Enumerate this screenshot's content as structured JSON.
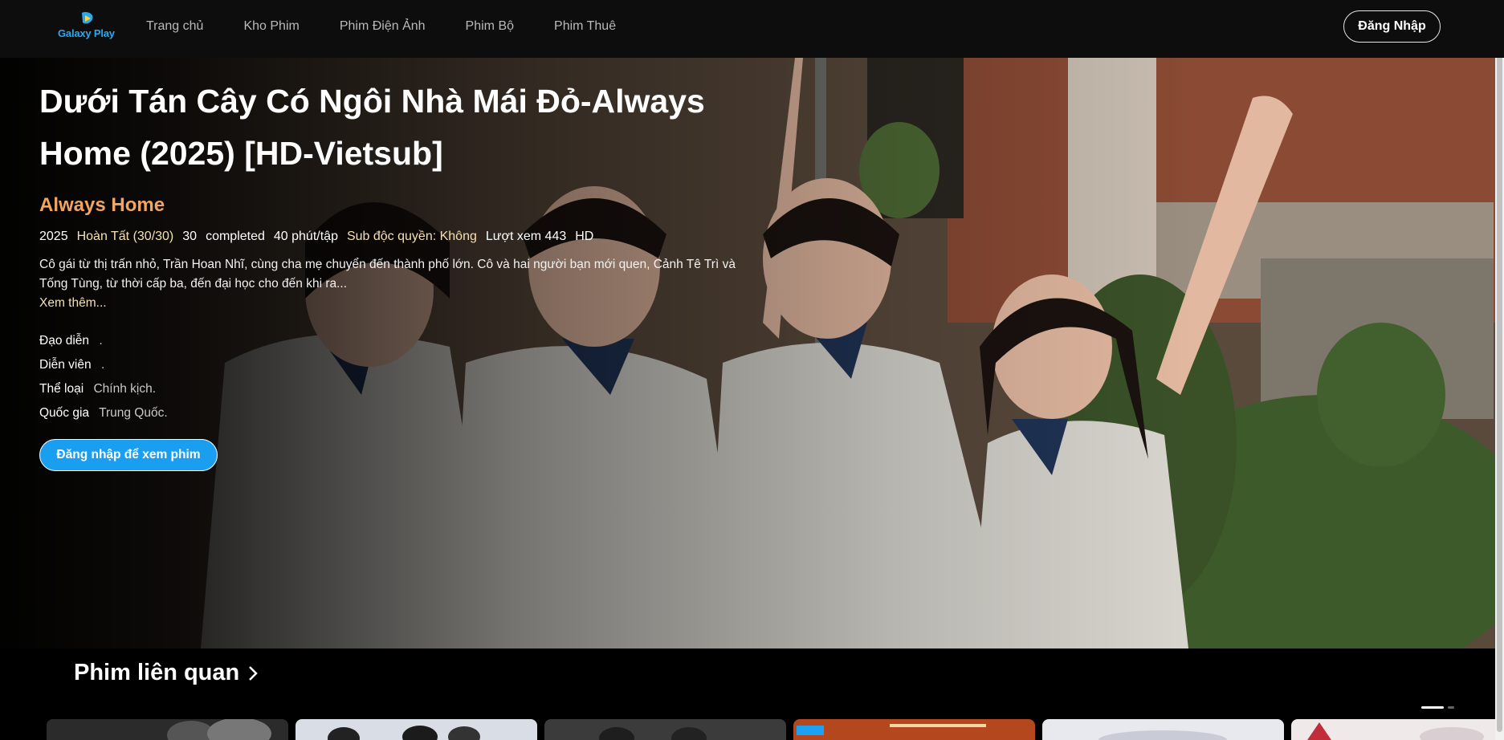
{
  "header": {
    "logo_text": "Galaxy Play",
    "nav": [
      "Trang chủ",
      "Kho Phim",
      "Phim Điện Ảnh",
      "Phim Bộ",
      "Phim Thuê"
    ],
    "login_label": "Đăng Nhập"
  },
  "hero": {
    "title": "Dưới Tán Cây Có Ngôi Nhà Mái Đỏ-Always Home (2025) [HD-Vietsub]",
    "subtitle": "Always Home",
    "meta": {
      "year": "2025",
      "status": "Hoàn Tất (30/30)",
      "episodes": "30",
      "state": "completed",
      "duration": "40 phút/tập",
      "sub": "Sub độc quyền: Không",
      "views": "Lượt xem 443",
      "quality": "HD"
    },
    "description": "Cô gái từ thị trấn nhỏ, Trần Hoan Nhĩ, cùng cha mẹ chuyển đến thành phố lớn. Cô và hai người bạn mới quen, Cảnh Tê Trì và Tống Tùng, từ thời cấp ba, đến đại học cho đến khi ra...",
    "see_more": "Xem thêm...",
    "info": {
      "director_label": "Đạo diễn",
      "director_value": ".",
      "cast_label": "Diễn viên",
      "cast_value": ".",
      "genre_label": "Thể loại",
      "genre_value": "Chính kịch.",
      "country_label": "Quốc gia",
      "country_value": "Trung Quốc."
    },
    "watch_label": "Đăng nhập để xem phim"
  },
  "related": {
    "title": "Phim liên quan"
  },
  "colors": {
    "accent": "#1a9ff0",
    "subtitle": "#f0a564",
    "background": "#000000"
  }
}
